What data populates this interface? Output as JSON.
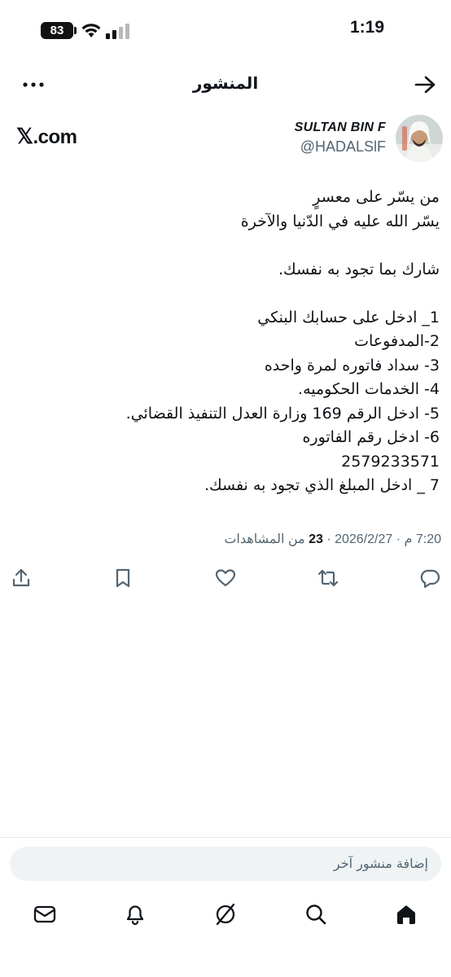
{
  "status_bar": {
    "time": "1:19",
    "battery": "83"
  },
  "header": {
    "title": "المنشور"
  },
  "author": {
    "name": "SULTAN BIN F",
    "handle": "@HADALSlF",
    "source": ".com",
    "source_mark": "𝕏"
  },
  "tweet": {
    "lines": [
      "من يسّر على معسرٍ",
      "يسّر الله عليه في الدّنيا والآخرة",
      "",
      "شارك بما تجود به نفسك.",
      "",
      "1_ ادخل على حسابك البنكي",
      "2-المدفوعات",
      "3- سداد فاتوره لمرة واحده",
      "4- الخدمات الحكوميه.",
      "5- ادخل الرقم 169 وزارة العدل التنفيذ القضائي.",
      "6- ادخل رقم الفاتوره",
      "2579233571",
      "7 _ ادخل المبلغ الذي تجود به نفسك."
    ],
    "meta": {
      "datetime": "7:20 م · 2026/2/27",
      "separator": "·",
      "views_count": "23",
      "views_label": "من المشاهدات"
    }
  },
  "actions": [
    {
      "name": "share-icon"
    },
    {
      "name": "bookmark-icon"
    },
    {
      "name": "like-icon"
    },
    {
      "name": "repost-icon"
    },
    {
      "name": "reply-icon"
    }
  ],
  "reply": {
    "placeholder": "إضافة منشور آخر"
  },
  "bottom_nav": [
    "messages-icon",
    "notifications-icon",
    "grok-icon",
    "search-icon",
    "home-icon"
  ]
}
